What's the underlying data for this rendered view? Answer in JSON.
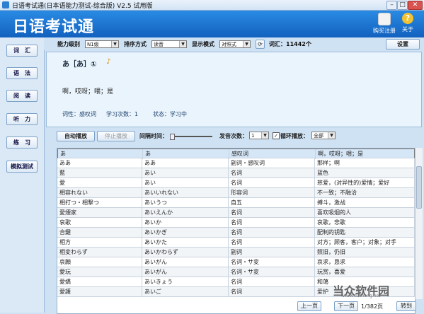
{
  "window": {
    "title": "日语考试通(日本语能力测试-综合版) V2.5 试用版",
    "minimize": "–",
    "maximize": "□",
    "close": "✕"
  },
  "header": {
    "brand": "日语考试通",
    "register": "购买注册",
    "about": "关于"
  },
  "sidebar": {
    "items": [
      {
        "label": "词　汇"
      },
      {
        "label": "语　法"
      },
      {
        "label": "阅　读"
      },
      {
        "label": "听　力"
      },
      {
        "label": "练　习"
      },
      {
        "label": "模拟测试"
      }
    ]
  },
  "toolbar": {
    "level_label": "能力级别",
    "level_value": "N1级",
    "sort_label": "排序方式",
    "sort_value": "读音",
    "display_label": "显示模式",
    "display_value": "对照式",
    "vocab_count": "词汇：11442个",
    "settings": "设置"
  },
  "word": {
    "headword": "あ［あ］①",
    "meaning": "啊，哎呀；喂；是",
    "pos": "词性：感叹词",
    "study_count": "学习次数：1",
    "status": "状态：学习中"
  },
  "controls": {
    "auto_play": "自动播放",
    "stop_play": "停止播放",
    "interval_label": "间隔时间：",
    "repeat_label": "发音次数：",
    "repeat_value": "1",
    "loop_label": "循环播放：",
    "loop_value": "全部"
  },
  "table": {
    "rows": [
      [
        "あ",
        "あ",
        "感叹词",
        "啊，哎呀；喂；是"
      ],
      [
        "ああ",
        "ああ",
        "副词・感叹词",
        "那样；啊"
      ],
      [
        "藍",
        "あい",
        "名词",
        "蓝色"
      ],
      [
        "愛",
        "あい",
        "名词",
        "慈爱，(对异性的)爱情；爱好"
      ],
      [
        "相容れない",
        "あいいれない",
        "形容词",
        "不一致；不融洽"
      ],
      [
        "相打つ・相撃つ",
        "あいうつ",
        "自五",
        "搏斗，激战"
      ],
      [
        "愛煙家",
        "あいえんか",
        "名词",
        "喜欢吸烟的人"
      ],
      [
        "哀歌",
        "あいか",
        "名词",
        "哀歌，悲歌"
      ],
      [
        "合鍵",
        "あいかぎ",
        "名词",
        "配制的钥匙"
      ],
      [
        "相方",
        "あいかた",
        "名词",
        "对方；顾客，客户；对象；对手"
      ],
      [
        "相変わらず",
        "あいかわらず",
        "副词",
        "照旧，仍旧"
      ],
      [
        "哀願",
        "あいがん",
        "名词・サ変",
        "哀求，恳求"
      ],
      [
        "愛玩",
        "あいがん",
        "名词・サ変",
        "玩赏，喜爱"
      ],
      [
        "愛嬌",
        "あいきょう",
        "名词",
        "和蔼"
      ],
      [
        "愛護",
        "あいご",
        "名词",
        "爱护"
      ]
    ]
  },
  "pager": {
    "prev": "上一页",
    "next": "下一页",
    "page": "1/382页",
    "goto": "转到"
  },
  "watermark": {
    "text": "当众软件园",
    "url": "www.dazhong.net"
  },
  "colors": {
    "header_blue": "#1a72d0",
    "panel_bg": "#eaf4fc",
    "window_bg": "#cfe2f3"
  }
}
